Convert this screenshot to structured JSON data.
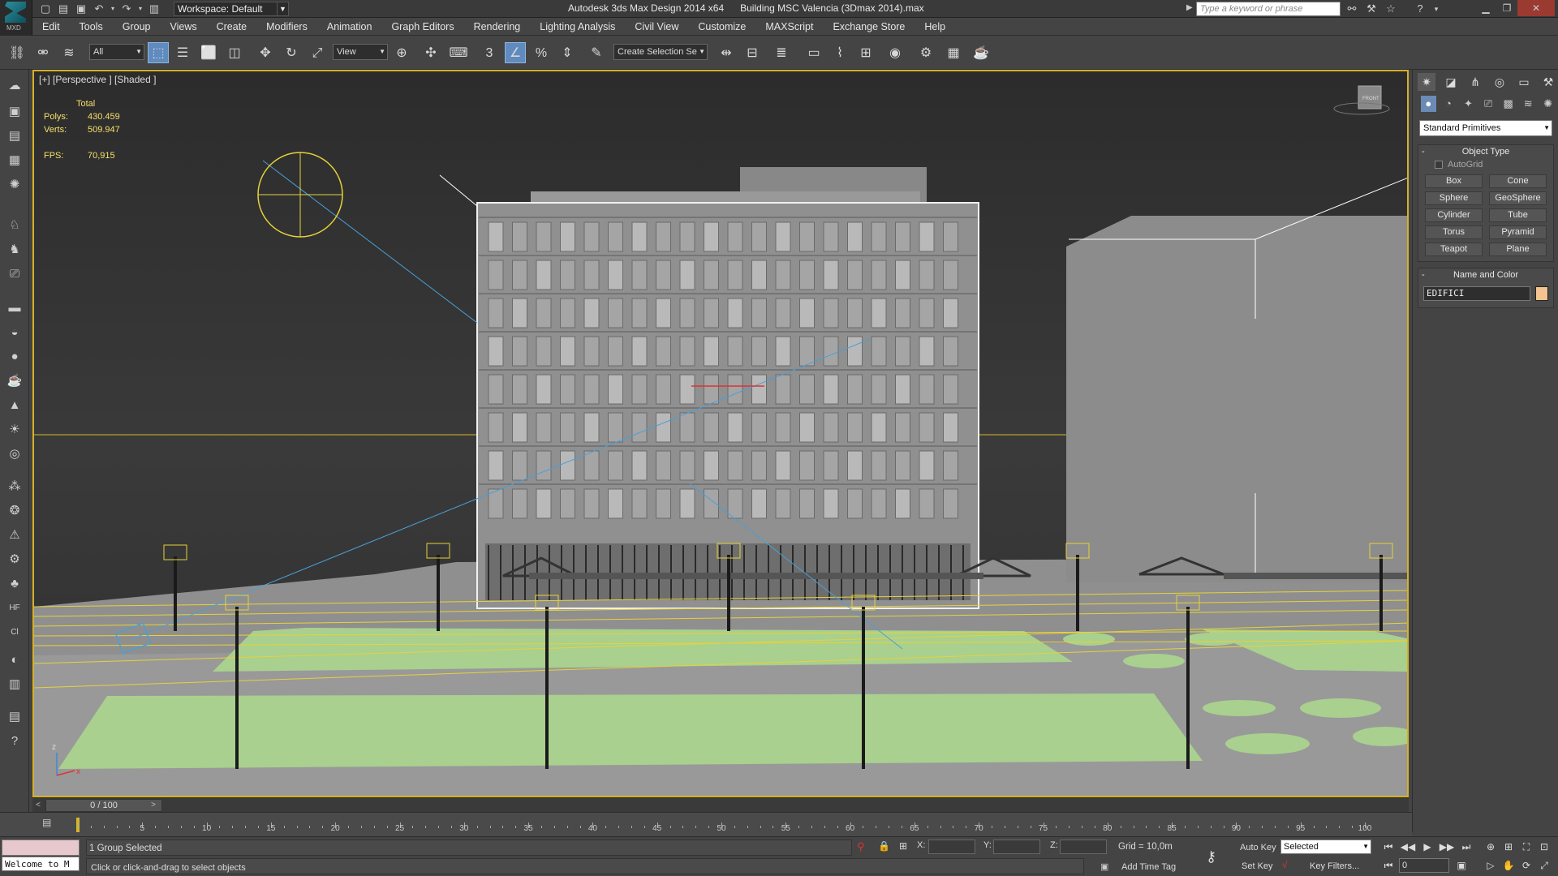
{
  "app": {
    "title": "Autodesk 3ds Max Design 2014 x64      Building MSC Valencia (3Dmax 2014).max",
    "logo_text": "MXD",
    "workspace": "Workspace: Default",
    "search_placeholder": "Type a keyword or phrase"
  },
  "menus": [
    "Edit",
    "Tools",
    "Group",
    "Views",
    "Create",
    "Modifiers",
    "Animation",
    "Graph Editors",
    "Rendering",
    "Lighting Analysis",
    "Civil View",
    "Customize",
    "MAXScript",
    "Exchange Store",
    "Help"
  ],
  "toolbar": {
    "selection_filter": "All",
    "ref_coord": "View",
    "named_selection": "Create Selection Se"
  },
  "viewport": {
    "label": "[+] [Perspective ] [Shaded ]",
    "stats_title": "Total",
    "stats": [
      {
        "key": "Polys:",
        "value": "430.459"
      },
      {
        "key": "Verts:",
        "value": "509.947"
      }
    ],
    "fps_key": "FPS:",
    "fps_value": "70,915",
    "viewcube_label": "FRONT",
    "axis_x": "x",
    "axis_z": "z"
  },
  "command_panel": {
    "category": "Standard Primitives",
    "object_type_title": "Object Type",
    "autogrid_label": "AutoGrid",
    "primitives": [
      "Box",
      "Cone",
      "Sphere",
      "GeoSphere",
      "Cylinder",
      "Tube",
      "Torus",
      "Pyramid",
      "Teapot",
      "Plane"
    ],
    "name_color_title": "Name and Color",
    "object_name": "EDIFICI",
    "object_color": "#f3c48f"
  },
  "timeline": {
    "frame_display": "0 / 100",
    "ticks": [
      "5",
      "10",
      "15",
      "20",
      "25",
      "30",
      "35",
      "40",
      "45",
      "50",
      "55",
      "60",
      "65",
      "70",
      "75",
      "80",
      "85",
      "90",
      "95",
      "100"
    ]
  },
  "status": {
    "welcome": "Welcome to M",
    "selection": "1 Group Selected",
    "prompt": "Click or click-and-drag to select objects",
    "x_label": "X:",
    "y_label": "Y:",
    "z_label": "Z:",
    "grid": "Grid = 10,0m",
    "add_time_tag": "Add Time Tag",
    "auto_key": "Auto Key",
    "set_key": "Set Key",
    "key_mode": "Selected",
    "key_filters": "Key Filters...",
    "current_frame": "0"
  },
  "colors": {
    "viewport_border": "#d4b12a",
    "grass": "#a9d08e",
    "building": "#8a8a8a",
    "light_yellow": "#e6d23a",
    "target_blue": "#4a9fd8"
  }
}
